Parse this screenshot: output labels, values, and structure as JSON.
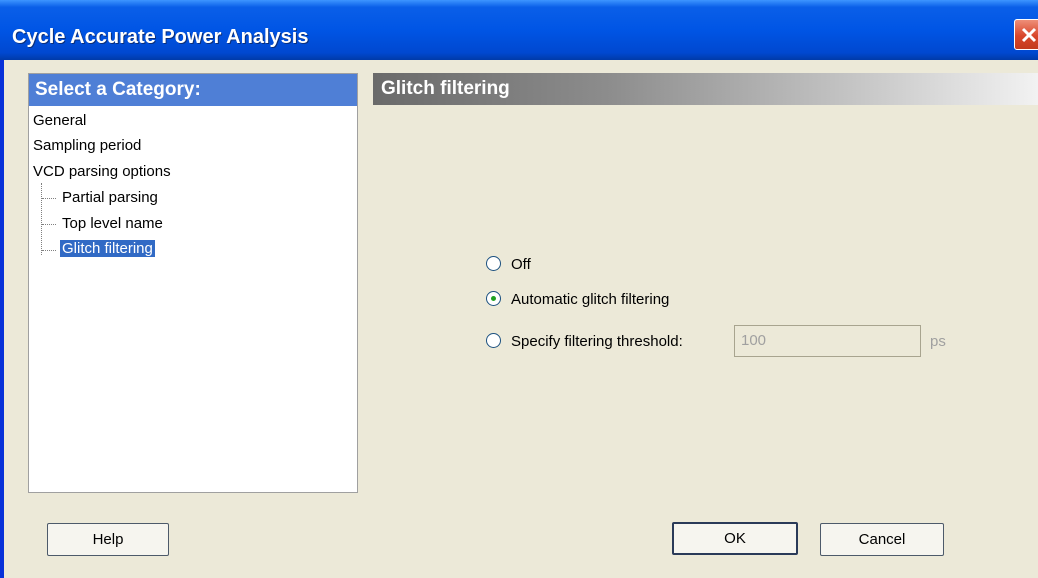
{
  "window": {
    "title": "Cycle Accurate Power Analysis"
  },
  "categories": {
    "header": "Select a Category:",
    "items": [
      {
        "label": "General",
        "selected": false
      },
      {
        "label": "Sampling period",
        "selected": false
      },
      {
        "label": "VCD parsing options",
        "selected": false
      },
      {
        "label": "Partial parsing",
        "selected": false
      },
      {
        "label": "Top level name",
        "selected": false
      },
      {
        "label": "Glitch filtering",
        "selected": true
      }
    ]
  },
  "section": {
    "title": "Glitch filtering"
  },
  "options": [
    {
      "label": "Off",
      "checked": false
    },
    {
      "label": "Automatic glitch filtering",
      "checked": true
    },
    {
      "label": "Specify filtering threshold:",
      "checked": false
    }
  ],
  "threshold": {
    "value": "100",
    "unit": "ps",
    "enabled": false
  },
  "buttons": {
    "help": "Help",
    "ok": "OK",
    "cancel": "Cancel"
  },
  "colors": {
    "title_bar": "#0055e5",
    "category_header": "#4f7fd6",
    "selection": "#316ac5",
    "dialog_bg": "#ece9d8"
  }
}
